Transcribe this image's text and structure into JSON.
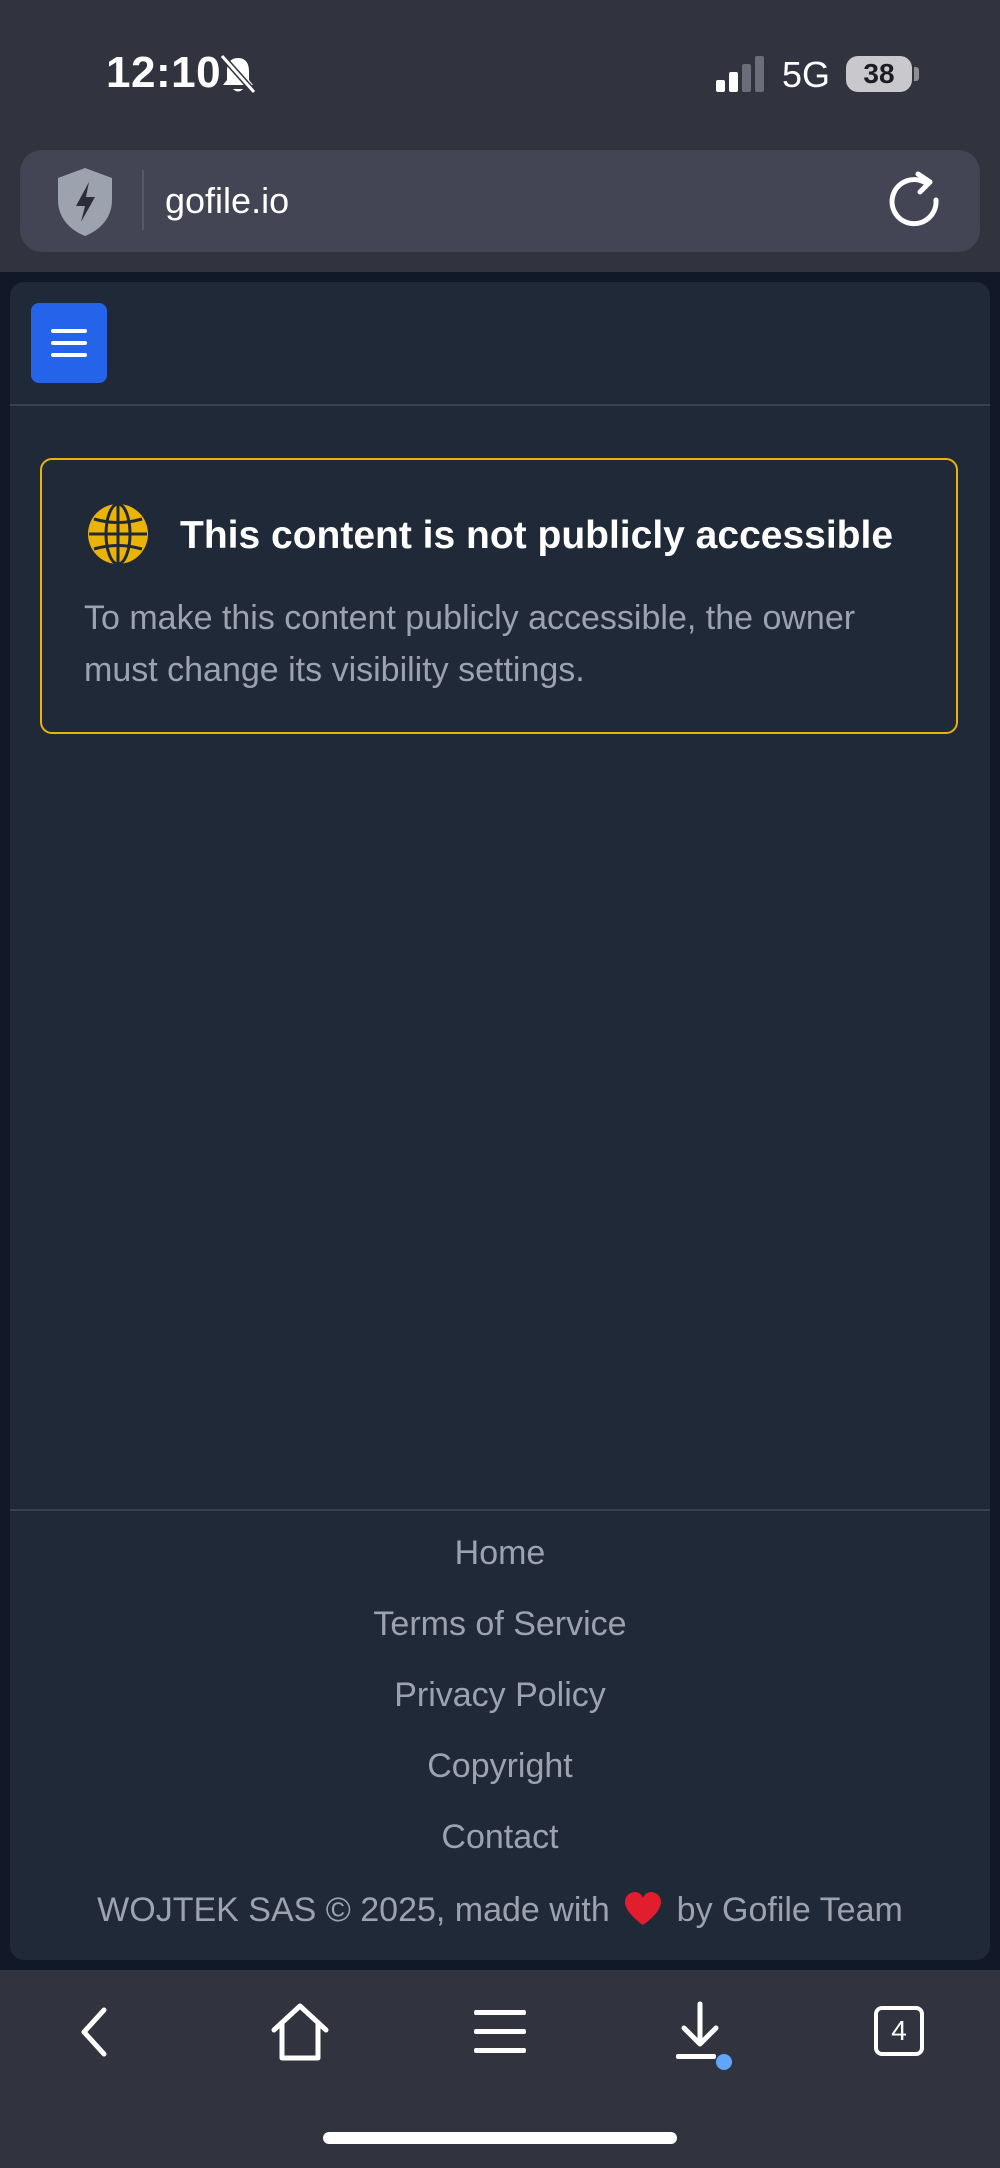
{
  "status_bar": {
    "time": "12:10",
    "network": "5G",
    "battery": "38",
    "icons": [
      "bell-slash-icon",
      "cellular-signal-icon",
      "battery-icon"
    ]
  },
  "browser": {
    "url": "gofile.io",
    "icons": [
      "shield-icon",
      "reload-icon"
    ]
  },
  "page": {
    "menu_icon": "hamburger-icon",
    "alert": {
      "icon": "globe-icon",
      "title": "This content is not publicly accessible",
      "body": "To make this content publicly accessible, the owner must change its visibility settings."
    },
    "footer": {
      "links": [
        "Home",
        "Terms of Service",
        "Privacy Policy",
        "Copyright",
        "Contact"
      ],
      "credit_prefix": "WOJTEK SAS © 2025, made with",
      "credit_suffix": "by Gofile Team"
    }
  },
  "toolbar": {
    "tab_count": "4",
    "icons": [
      "back-icon",
      "home-icon",
      "menu-icon",
      "download-icon",
      "tabs-icon"
    ]
  },
  "colors": {
    "accent": "#2563eb",
    "warning": "#eab308",
    "card": "#1f2937",
    "chrome": "#31333f"
  }
}
